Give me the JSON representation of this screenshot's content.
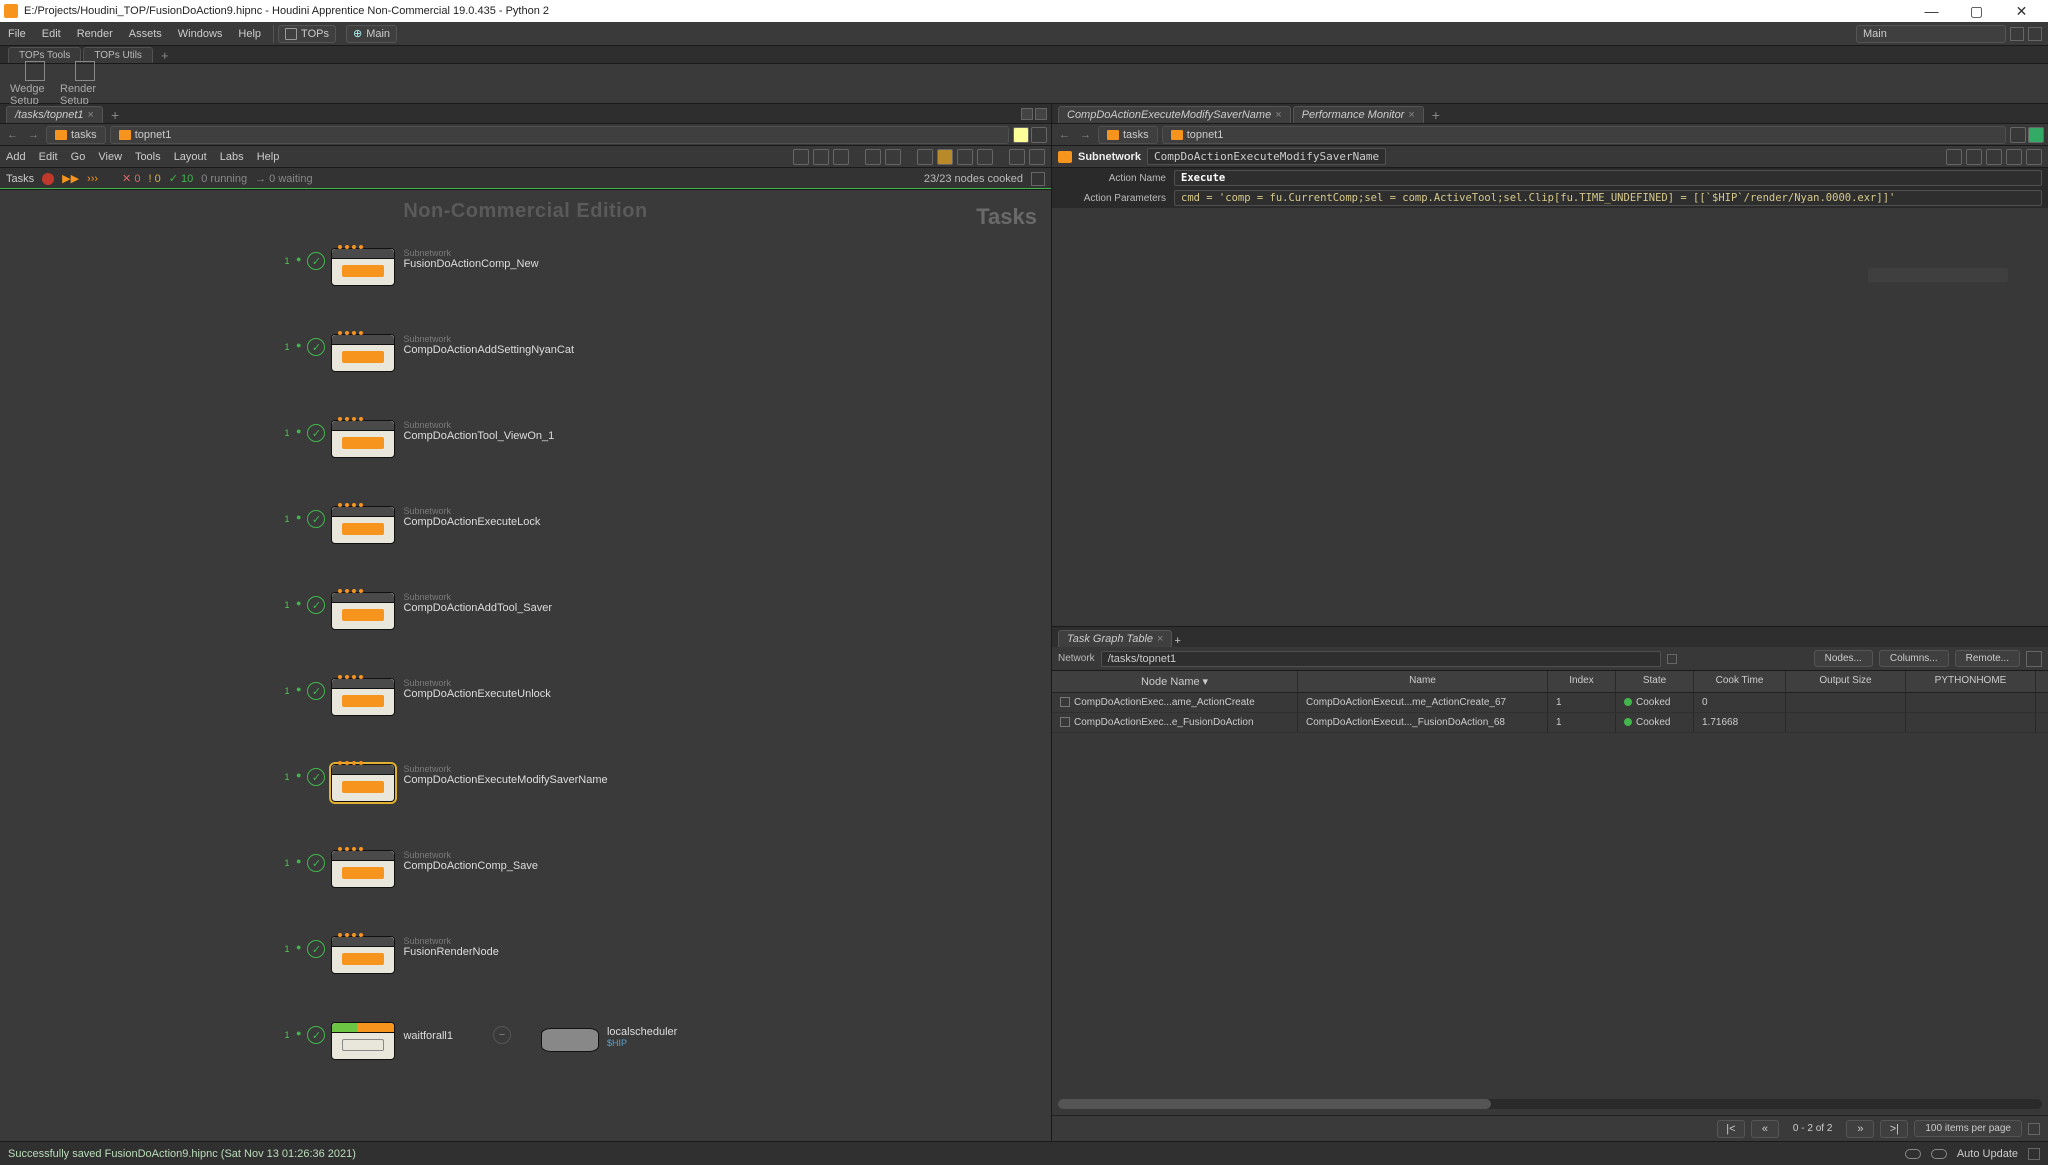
{
  "window": {
    "title": "E:/Projects/Houdini_TOP/FusionDoAction9.hipnc - Houdini Apprentice Non-Commercial 19.0.435 - Python 2",
    "min_label": "—",
    "max_label": "▢",
    "close_label": "✕"
  },
  "menubar": {
    "items": [
      "File",
      "Edit",
      "Render",
      "Assets",
      "Windows",
      "Help"
    ],
    "desktop_label": "TOPs",
    "scene_label": "Main",
    "right_scene_label": "Main"
  },
  "shelf": {
    "tabs": [
      "TOPs Tools",
      "TOPs Utils"
    ],
    "tools": [
      {
        "label": "Wedge Setup"
      },
      {
        "label": "Render Setup"
      }
    ]
  },
  "left_pane": {
    "tab_label": "/tasks/topnet1",
    "path_segments": [
      "tasks",
      "topnet1"
    ],
    "toolbar_menus": [
      "Add",
      "Edit",
      "Go",
      "View",
      "Tools",
      "Layout",
      "Labs",
      "Help"
    ],
    "task_bar": {
      "label": "Tasks",
      "x_count": "0",
      "warn_count": "0",
      "ok_count": "10",
      "running": "0 running",
      "waiting": "0 waiting",
      "cooked": "23/23 nodes cooked",
      "x_prefix": "✕",
      "warn_prefix": "!",
      "ok_prefix": "✓",
      "arrow_prefix": "→"
    },
    "watermark_top": "Non-Commercial Edition",
    "watermark_right": "Tasks",
    "nodes": [
      {
        "sub": "Subnetwork",
        "name": "FusionDoActionComp_New",
        "badge": "1",
        "checked": true,
        "selected": false
      },
      {
        "sub": "Subnetwork",
        "name": "CompDoActionAddSettingNyanCat",
        "badge": "1",
        "checked": true,
        "selected": false
      },
      {
        "sub": "Subnetwork",
        "name": "CompDoActionTool_ViewOn_1",
        "badge": "1",
        "checked": true,
        "selected": false
      },
      {
        "sub": "Subnetwork",
        "name": "CompDoActionExecuteLock",
        "badge": "1",
        "checked": true,
        "selected": false
      },
      {
        "sub": "Subnetwork",
        "name": "CompDoActionAddTool_Saver",
        "badge": "1",
        "checked": true,
        "selected": false
      },
      {
        "sub": "Subnetwork",
        "name": "CompDoActionExecuteUnlock",
        "badge": "1",
        "checked": true,
        "selected": false
      },
      {
        "sub": "Subnetwork",
        "name": "CompDoActionExecuteModifySaverName",
        "badge": "1",
        "checked": true,
        "selected": true
      },
      {
        "sub": "Subnetwork",
        "name": "CompDoActionComp_Save",
        "badge": "1",
        "checked": true,
        "selected": false
      },
      {
        "sub": "Subnetwork",
        "name": "FusionRenderNode",
        "badge": "1",
        "checked": true,
        "selected": false
      }
    ],
    "end_row": {
      "wait_name": "waitforall1",
      "sched_name": "localscheduler",
      "sched_tag": "$HIP"
    }
  },
  "right_pane": {
    "tabs": [
      "CompDoActionExecuteModifySaverName",
      "Performance Monitor"
    ],
    "path_segments": [
      "tasks",
      "topnet1"
    ],
    "parm_box": {
      "type_label": "Subnetwork",
      "name": "CompDoActionExecuteModifySaverName",
      "rows": [
        {
          "label": "Action Name",
          "value": "Execute",
          "bold": true
        },
        {
          "label": "Action Parameters",
          "value": "cmd = 'comp = fu.CurrentComp;sel = comp.ActiveTool;sel.Clip[fu.TIME_UNDEFINED] = [[`$HIP`/render/Nyan.0000.exr]]'",
          "expr": true
        }
      ]
    }
  },
  "task_graph_table": {
    "tab_label": "Task Graph Table",
    "network_label": "Network",
    "network_path": "/tasks/topnet1",
    "buttons": [
      "Nodes...",
      "Columns...",
      "Remote..."
    ],
    "columns": [
      "Node Name",
      "Name",
      "Index",
      "State",
      "Cook Time",
      "Output Size",
      "PYTHONHOME"
    ],
    "rows": [
      {
        "node": "CompDoActionExec...ame_ActionCreate",
        "name": "CompDoActionExecut...me_ActionCreate_67",
        "index": "1",
        "state": "Cooked",
        "cook": "0",
        "out": "",
        "py": ""
      },
      {
        "node": "CompDoActionExec...e_FusionDoAction",
        "name": "CompDoActionExecut..._FusionDoAction_68",
        "index": "1",
        "state": "Cooked",
        "cook": "1.71668",
        "out": "",
        "py": ""
      }
    ],
    "pager": {
      "info": "0 - 2 of 2",
      "per_page": "100 items per page",
      "first": "|<",
      "prev": "«",
      "next": "»",
      "last": ">|"
    }
  },
  "statusbar": {
    "message": "Successfully saved FusionDoAction9.hipnc (Sat Nov 13 01:26:36 2021)",
    "update_label": "Auto Update"
  }
}
